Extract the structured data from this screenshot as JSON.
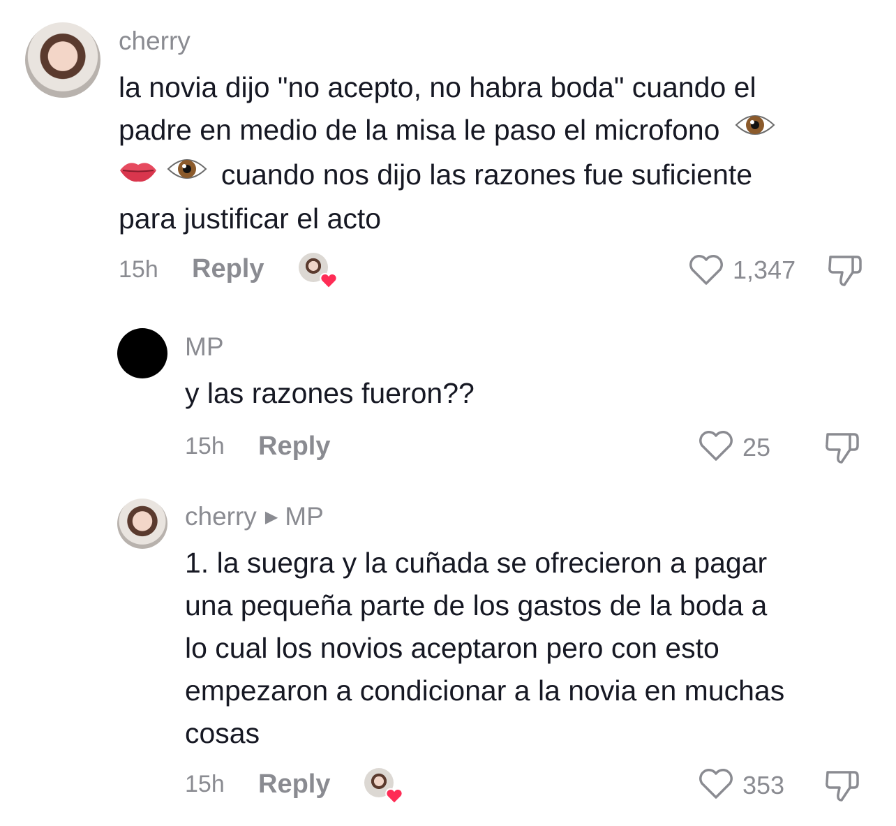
{
  "comments": [
    {
      "username": "cherry",
      "text_lines": [
        "la novia dijo \"no acepto, no habra boda\" cuando el",
        "padre en medio de la misa le paso el microfono",
        "cuando nos dijo las razones fue suficiente",
        "para justificar el acto"
      ],
      "time": "15h",
      "reply_label": "Reply",
      "likes": "1,347",
      "creator_liked": true
    },
    {
      "username": "MP",
      "text_lines": [
        "y las razones fueron??"
      ],
      "time": "15h",
      "reply_label": "Reply",
      "likes": "25",
      "creator_liked": false
    },
    {
      "username": "cherry",
      "reply_to": "MP",
      "text_lines": [
        "1. la suegra y la cuñada se ofrecieron a pagar",
        "una pequeña parte de los gastos de la boda a",
        "lo cual los novios aceptaron pero con esto",
        "empezaron a condicionar a la novia en muchas",
        "cosas"
      ],
      "time": "15h",
      "reply_label": "Reply",
      "likes": "353",
      "creator_liked": true
    }
  ],
  "icons": {
    "like": "heart-outline-icon",
    "dislike": "thumbs-down-icon",
    "eye_emoji": "eye-emoji",
    "lips_emoji": "lips-emoji",
    "reply_arrow": "reply-arrow-icon",
    "creator_heart": "heart-filled-icon"
  },
  "colors": {
    "text": "#161823",
    "secondary": "#8a8b91",
    "heart_red": "#fe2c55"
  }
}
